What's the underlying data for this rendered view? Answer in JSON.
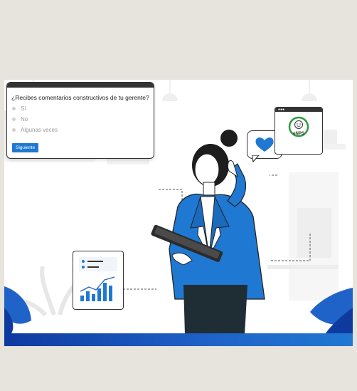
{
  "survey": {
    "question": "¿Recibes comentarios constructivos de tu gerente?",
    "options": [
      "Sí",
      "No",
      "Algunas veces"
    ],
    "button_label": "Siguiente"
  },
  "enps_card": {
    "label": "eNPS"
  },
  "colors": {
    "accent_blue": "#1f78d1",
    "dark_blue": "#0e3aa0",
    "green_ring": "#2e9a3e",
    "background_band": "#e6e4dc"
  },
  "icons": [
    "heart-icon",
    "smile-icon",
    "bar-chart-icon",
    "id-card-icon",
    "tablet-icon"
  ]
}
